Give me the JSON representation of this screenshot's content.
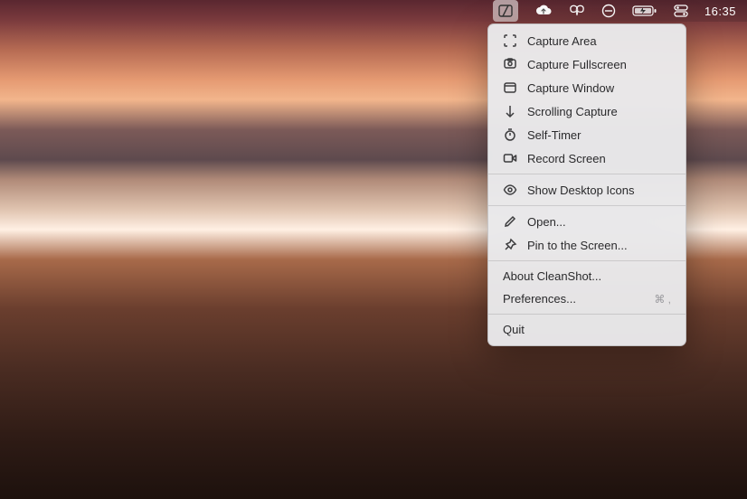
{
  "menubar": {
    "clock": "16:35"
  },
  "menu": {
    "items": [
      {
        "icon": "capture-area-icon",
        "label": "Capture Area"
      },
      {
        "icon": "capture-fullscreen-icon",
        "label": "Capture Fullscreen"
      },
      {
        "icon": "capture-window-icon",
        "label": "Capture Window"
      },
      {
        "icon": "scrolling-capture-icon",
        "label": "Scrolling Capture"
      },
      {
        "icon": "self-timer-icon",
        "label": "Self-Timer"
      },
      {
        "icon": "record-screen-icon",
        "label": "Record Screen"
      }
    ],
    "desktop": {
      "label": "Show Desktop Icons"
    },
    "open": {
      "label": "Open..."
    },
    "pin": {
      "label": "Pin to the Screen..."
    },
    "about": {
      "label": "About CleanShot..."
    },
    "prefs": {
      "label": "Preferences...",
      "shortcut": "⌘ ,"
    },
    "quit": {
      "label": "Quit"
    }
  }
}
